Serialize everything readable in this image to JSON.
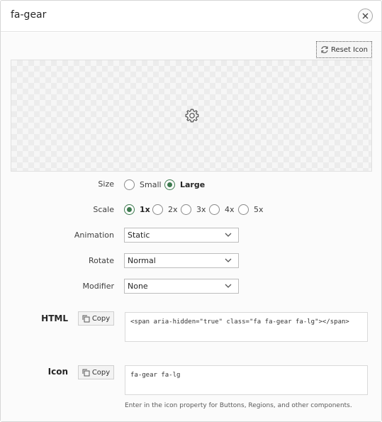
{
  "dialog": {
    "title": "fa-gear"
  },
  "toolbar": {
    "reset_label": "Reset Icon"
  },
  "preview": {
    "icon": "gear-icon"
  },
  "size": {
    "label": "Size",
    "options": [
      "Small",
      "Large"
    ],
    "selected": "Large"
  },
  "scale": {
    "label": "Scale",
    "options": [
      "1x",
      "2x",
      "3x",
      "4x",
      "5x"
    ],
    "selected": "1x"
  },
  "animation": {
    "label": "Animation",
    "value": "Static"
  },
  "rotate": {
    "label": "Rotate",
    "value": "Normal"
  },
  "modifier": {
    "label": "Modifier",
    "value": "None"
  },
  "html_section": {
    "label": "HTML",
    "copy_label": "Copy",
    "code": "<span aria-hidden=\"true\" class=\"fa fa-gear fa-lg\"></span>"
  },
  "icon_section": {
    "label": "Icon",
    "copy_label": "Copy",
    "code": "fa-gear fa-lg",
    "help": "Enter in the icon property for Buttons, Regions, and other components."
  },
  "colors": {
    "accent": "#3d7a4f",
    "border": "#d6d6d6"
  }
}
